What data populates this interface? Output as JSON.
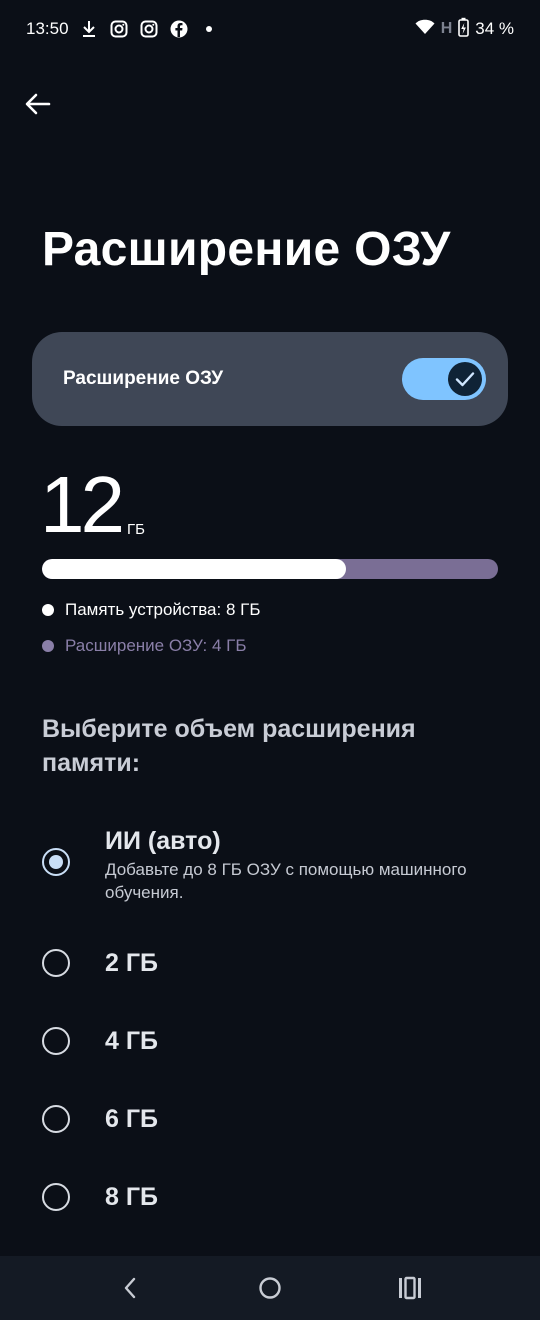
{
  "status_bar": {
    "time": "13:50",
    "network_label": "H",
    "battery_text": "34 %",
    "left_icons": [
      "download-icon",
      "instagram-icon",
      "instagram-icon",
      "facebook-icon",
      "dot-icon"
    ],
    "right_icons": [
      "wifi-icon",
      "signal-icon",
      "battery-charging-icon"
    ]
  },
  "header": {
    "back_icon": "arrow-left-icon",
    "title": "Расширение ОЗУ"
  },
  "toggle": {
    "label": "Расширение ОЗУ",
    "enabled": true,
    "color_track": "#7fc4ff",
    "color_thumb": "#0f2336"
  },
  "memory": {
    "total_value": "12",
    "total_unit": "ГБ",
    "device_fraction": 0.667,
    "legend": [
      {
        "label": "Память устройства: 8 ГБ",
        "color": "#ffffff"
      },
      {
        "label": "Расширение ОЗУ: 4 ГБ",
        "color": "#8a7fa8"
      }
    ]
  },
  "section": {
    "title": "Выберите объем расширения памяти:"
  },
  "options": [
    {
      "label": "ИИ (авто)",
      "description": "Добавьте до 8 ГБ ОЗУ с помощью машинного обучения.",
      "selected": true
    },
    {
      "label": "2 ГБ",
      "description": "",
      "selected": false
    },
    {
      "label": "4 ГБ",
      "description": "",
      "selected": false
    },
    {
      "label": "6 ГБ",
      "description": "",
      "selected": false
    },
    {
      "label": "8 ГБ",
      "description": "",
      "selected": false
    }
  ],
  "nav_bar": {
    "icons": [
      "nav-back-icon",
      "nav-home-icon",
      "nav-recents-icon"
    ]
  }
}
